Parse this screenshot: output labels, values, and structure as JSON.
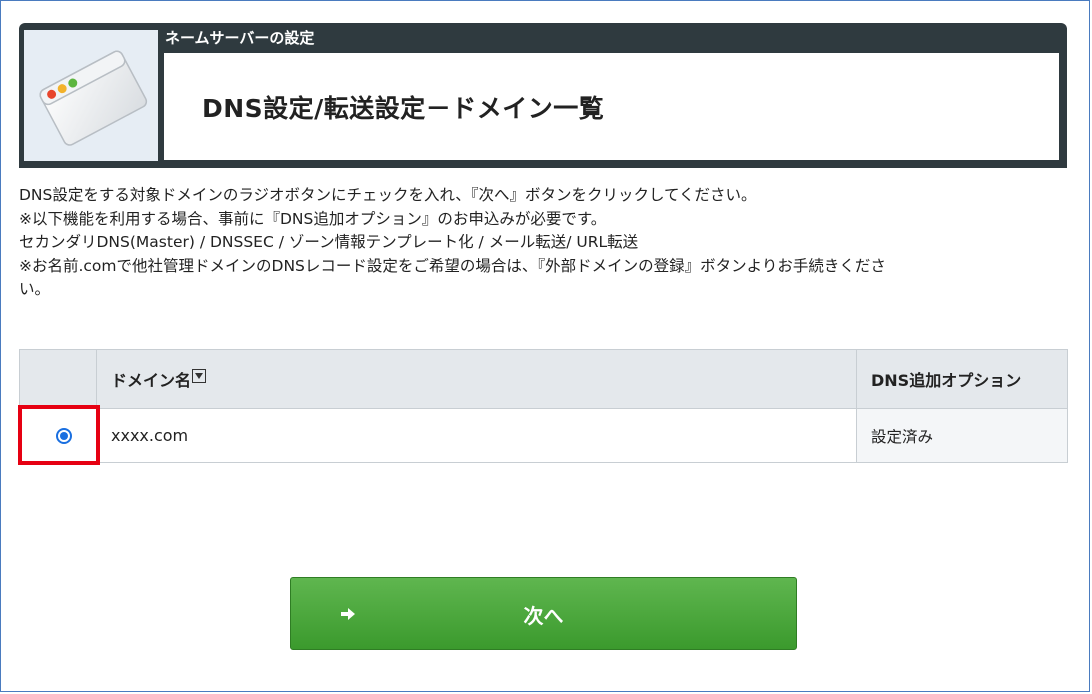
{
  "header": {
    "section_label": "ネームサーバーの設定",
    "page_title": "DNS設定/転送設定－ドメイン一覧"
  },
  "instructions": [
    "DNS設定をする対象ドメインのラジオボタンにチェックを入れ、『次へ』ボタンをクリックしてください。",
    "※以下機能を利用する場合、事前に『DNS追加オプション』のお申込みが必要です。",
    "セカンダリDNS(Master) / DNSSEC / ゾーン情報テンプレート化 / メール転送/ URL転送",
    "※お名前.comで他社管理ドメインのDNSレコード設定をご希望の場合は、『外部ドメインの登録』ボタンよりお手続きくださ",
    "い。"
  ],
  "table": {
    "headers": {
      "select": "",
      "domain": "ドメイン名",
      "option": "DNS追加オプション"
    },
    "rows": [
      {
        "selected": true,
        "domain": "xxxx.com",
        "option": "設定済み"
      }
    ]
  },
  "next_button": {
    "label": "次へ"
  },
  "icons": {
    "app": "browser-window-icon",
    "sort": "sort-down-icon",
    "arrow": "arrow-right-icon"
  },
  "colors": {
    "header_bg": "#2f3a3f",
    "button_green": "#4caa3c",
    "highlight_red": "#e60012",
    "radio_blue": "#1a6fe0"
  }
}
